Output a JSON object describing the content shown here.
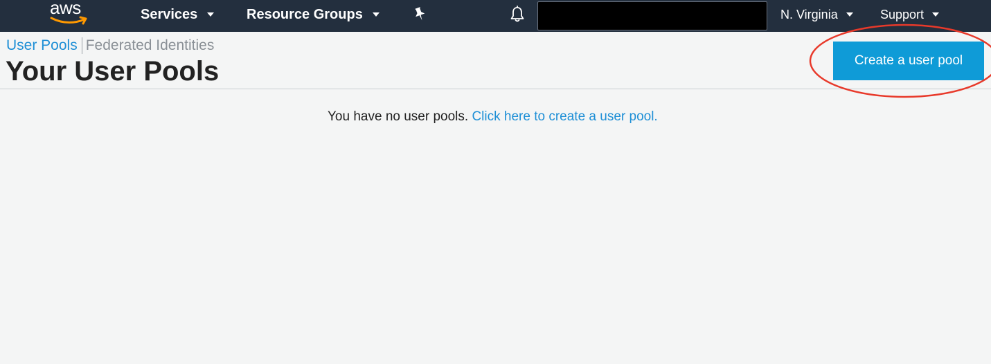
{
  "topnav": {
    "logo_text": "aws",
    "services_label": "Services",
    "resource_groups_label": "Resource Groups",
    "region_label": "N. Virginia",
    "support_label": "Support"
  },
  "header": {
    "tabs": [
      {
        "label": "User Pools"
      },
      {
        "label": "Federated Identities"
      }
    ],
    "title": "Your User Pools",
    "create_button_label": "Create a user pool"
  },
  "main": {
    "empty_message": "You have no user pools.",
    "create_link_label": "Click here to create a user pool."
  },
  "colors": {
    "nav_bg": "#232f3e",
    "accent_link": "#1e8fd6",
    "button_bg": "#0f9bd7",
    "annotation": "#e8392a",
    "logo_smile": "#ff9900"
  }
}
